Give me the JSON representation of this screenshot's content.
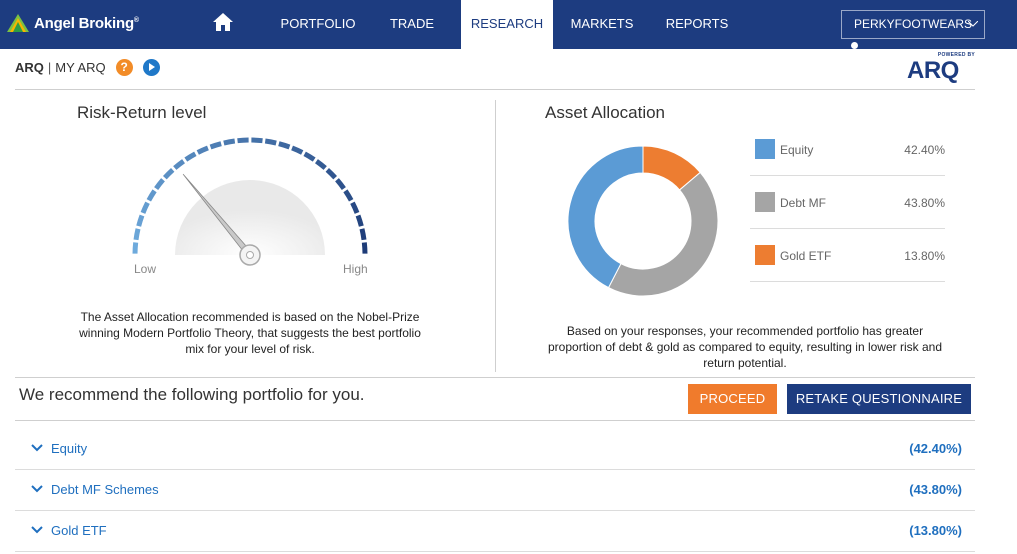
{
  "brand": {
    "name": "Angel Broking",
    "trademark": "®"
  },
  "nav": {
    "items": [
      {
        "label": "PORTFOLIO"
      },
      {
        "label": "TRADE"
      },
      {
        "label": "RESEARCH"
      },
      {
        "label": "MARKETS"
      },
      {
        "label": "REPORTS"
      }
    ],
    "active": "RESEARCH",
    "user": "PERKYFOOTWEARS"
  },
  "subheader": {
    "primary": "ARQ",
    "separator": "|",
    "secondary": "MY ARQ",
    "help_glyph": "?"
  },
  "arq_logo": {
    "powered_by": "POWERED BY",
    "text": "ARQ"
  },
  "risk": {
    "title": "Risk-Return level",
    "low_label": "Low",
    "high_label": "High",
    "level": 0.28,
    "description": "The Asset Allocation recommended is based on the Nobel-Prize winning Modern Portfolio Theory, that suggests the best portfolio mix for your level of risk."
  },
  "allocation": {
    "title": "Asset Allocation",
    "items": [
      {
        "label": "Equity",
        "value": "42.40%",
        "pct": 42.4,
        "color": "#5b9bd5"
      },
      {
        "label": "Debt MF",
        "value": "43.80%",
        "pct": 43.8,
        "color": "#a5a5a5"
      },
      {
        "label": "Gold ETF",
        "value": "13.80%",
        "pct": 13.8,
        "color": "#ed7d31"
      }
    ],
    "description": "Based on your responses, your recommended portfolio has greater proportion of debt & gold as compared to equity, resulting in lower risk and return potential."
  },
  "recommendation": {
    "title": "We recommend the following portfolio for you.",
    "proceed_label": "PROCEED",
    "retake_label": "RETAKE QUESTIONNAIRE",
    "rows": [
      {
        "label": "Equity",
        "value": "(42.40%)"
      },
      {
        "label": "Debt MF Schemes",
        "value": "(43.80%)"
      },
      {
        "label": "Gold ETF",
        "value": "(13.80%)"
      }
    ]
  },
  "colors": {
    "nav_bg": "#1d3c80",
    "accent_orange": "#f07b2c",
    "link_blue": "#1f6fbf"
  }
}
